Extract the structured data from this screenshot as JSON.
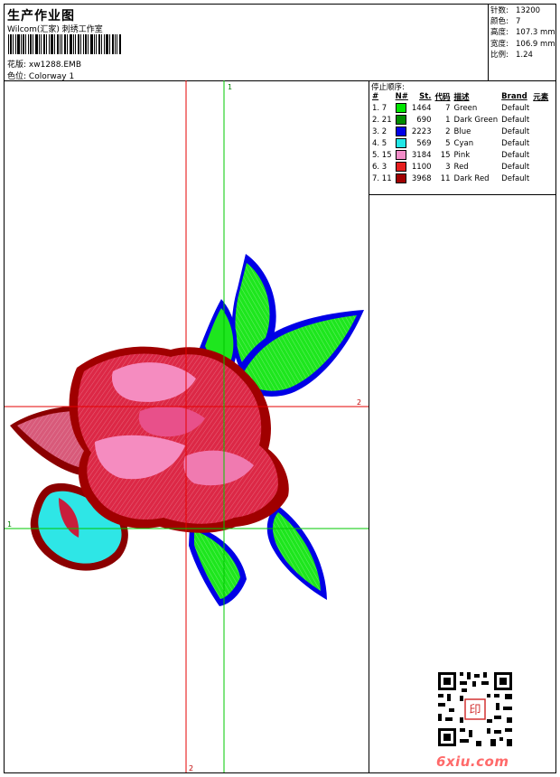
{
  "header": {
    "title": "生产作业图",
    "company": "Wilcom(汇家) 刺绣工作室",
    "design_label": "花版:",
    "design_value": "xw1288.EMB",
    "colorway_label": "色位:",
    "colorway_value": "Colorway 1"
  },
  "stats": [
    {
      "label": "针数:",
      "value": "13200"
    },
    {
      "label": "颜色:",
      "value": "7"
    },
    {
      "label": "高度:",
      "value": "107.3 mm"
    },
    {
      "label": "宽度:",
      "value": "106.9 mm"
    },
    {
      "label": "比例:",
      "value": "1.24"
    }
  ],
  "color_sequence": {
    "title": "停止顺序:",
    "headers": [
      "#",
      "N#",
      "St.",
      "代码",
      "描述",
      "Brand",
      "元素"
    ],
    "rows": [
      {
        "num": "1. 7",
        "color": "#00e600",
        "stitches": "1464",
        "code": "7",
        "desc": "Green",
        "brand": "Default"
      },
      {
        "num": "2. 21",
        "color": "#008c00",
        "stitches": "690",
        "code": "1",
        "desc": "Dark Green",
        "brand": "Default"
      },
      {
        "num": "3. 2",
        "color": "#0000e6",
        "stitches": "2223",
        "code": "2",
        "desc": "Blue",
        "brand": "Default"
      },
      {
        "num": "4. 5",
        "color": "#22e6e6",
        "stitches": "569",
        "code": "5",
        "desc": "Cyan",
        "brand": "Default"
      },
      {
        "num": "5. 15",
        "color": "#f28cc8",
        "stitches": "3184",
        "code": "15",
        "desc": "Pink",
        "brand": "Default"
      },
      {
        "num": "6. 3",
        "color": "#e61e1e",
        "stitches": "1100",
        "code": "3",
        "desc": "Red",
        "brand": "Default"
      },
      {
        "num": "7. 11",
        "color": "#a00000",
        "stitches": "3968",
        "code": "11",
        "desc": "Dark Red",
        "brand": "Default"
      }
    ]
  },
  "guides": {
    "green_top": "1",
    "green_left": "1",
    "red_right": "2",
    "red_bottom": "2"
  },
  "watermark": "6xiu.com",
  "qr_stamp": "印"
}
